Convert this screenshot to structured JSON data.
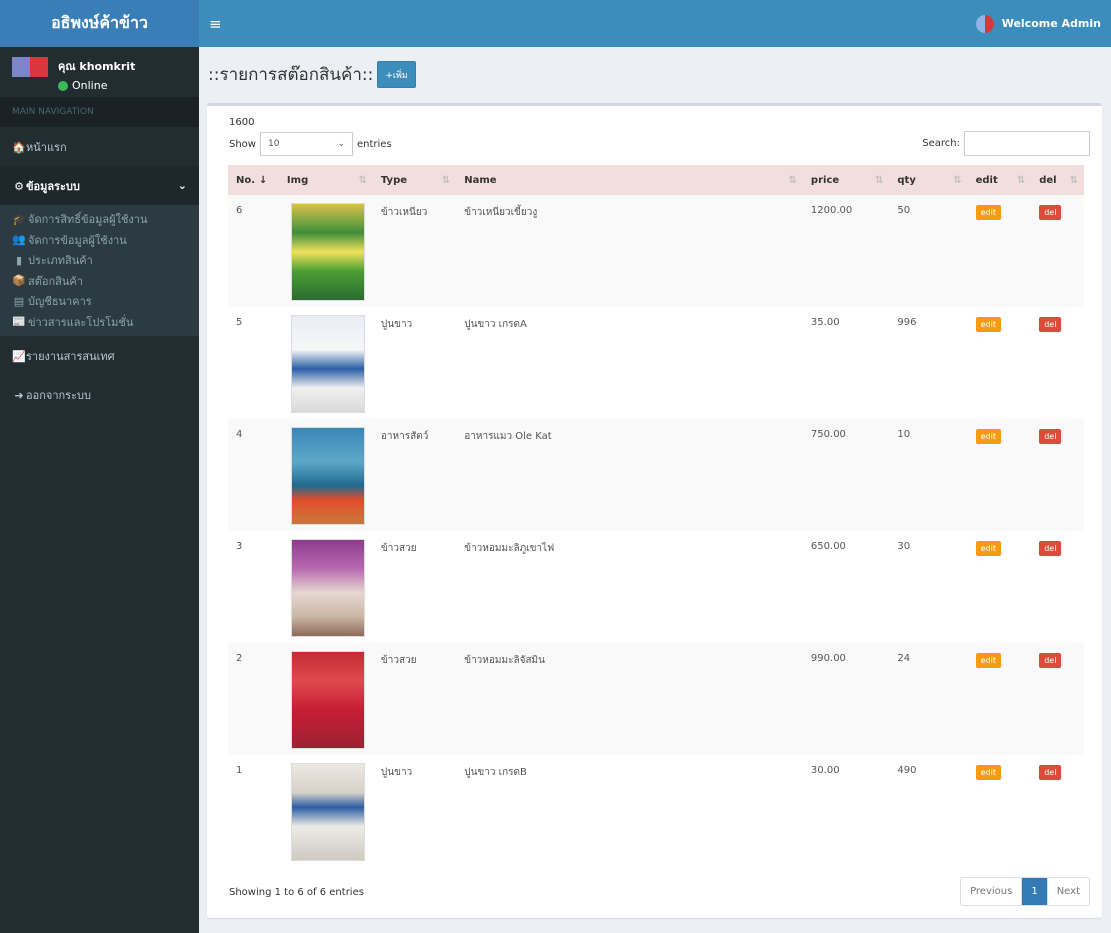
{
  "header": {
    "brand": "อธิพงษ์ค้าข้าว",
    "toggle_icon": "≡",
    "welcome": "Welcome Admin"
  },
  "sidebar": {
    "user_name": "คุณ khomkrit",
    "user_status": "Online",
    "nav_header": "MAIN NAVIGATION",
    "home": "หน้าแรก",
    "system_data": "ข้อมูลระบบ",
    "sub_items": [
      {
        "label": "จัดการสิทธิ์ข้อมูลผู้ใช้งาน",
        "icon": "🎓"
      },
      {
        "label": "จัดการข้อมูลผู้ใช้งาน",
        "icon": "👥"
      },
      {
        "label": "ประเภทสินค้า",
        "icon": "▮"
      },
      {
        "label": "สต๊อกสินค้า",
        "icon": "📦"
      },
      {
        "label": "บัญชีธนาคาร",
        "icon": "▤"
      },
      {
        "label": "ข่าวสารและโปรโมชั่น",
        "icon": "📰"
      }
    ],
    "report": "รายงานสารสนเทศ",
    "logout": "ออกจากระบบ"
  },
  "page": {
    "title": "::รายการสต๊อกสินค้า::",
    "add_button": "+เพิ่ม"
  },
  "table_controls": {
    "count": "1600",
    "show_label": "Show",
    "page_size": "10",
    "entries_label": "entries",
    "search_label": "Search:"
  },
  "table": {
    "columns": [
      "No.",
      "Img",
      "Type",
      "Name",
      "price",
      "qty",
      "edit",
      "del"
    ],
    "rows": [
      {
        "no": "6",
        "type": "ข้าวเหนียว",
        "name": "ข้าวเหนียวเขี้ยวงู",
        "price": "1200.00",
        "qty": "50",
        "edit": "edit",
        "del": "del"
      },
      {
        "no": "5",
        "type": "ปูนขาว",
        "name": "ปูนขาว เกรดA",
        "price": "35.00",
        "qty": "996",
        "edit": "edit",
        "del": "del"
      },
      {
        "no": "4",
        "type": "อาหารสัตว์",
        "name": "อาหารแมว Ole Kat",
        "price": "750.00",
        "qty": "10",
        "edit": "edit",
        "del": "del"
      },
      {
        "no": "3",
        "type": "ข้าวสวย",
        "name": "ข้าวหอมมะลิภูเขาไฟ",
        "price": "650.00",
        "qty": "30",
        "edit": "edit",
        "del": "del"
      },
      {
        "no": "2",
        "type": "ข้าวสวย",
        "name": "ข้าวหอมมะลิจัสมิน",
        "price": "990.00",
        "qty": "24",
        "edit": "edit",
        "del": "del"
      },
      {
        "no": "1",
        "type": "ปูนขาว",
        "name": "ปูนขาว เกรดB",
        "price": "30.00",
        "qty": "490",
        "edit": "edit",
        "del": "del"
      }
    ]
  },
  "footer": {
    "info": "Showing 1 to 6 of 6 entries",
    "previous": "Previous",
    "current_page": "1",
    "next": "Next"
  },
  "colors": {
    "header": "#3c8dbc",
    "sidebar": "#222d32",
    "thead": "#f2dede",
    "edit": "#f39c12",
    "del": "#dd4b39"
  }
}
